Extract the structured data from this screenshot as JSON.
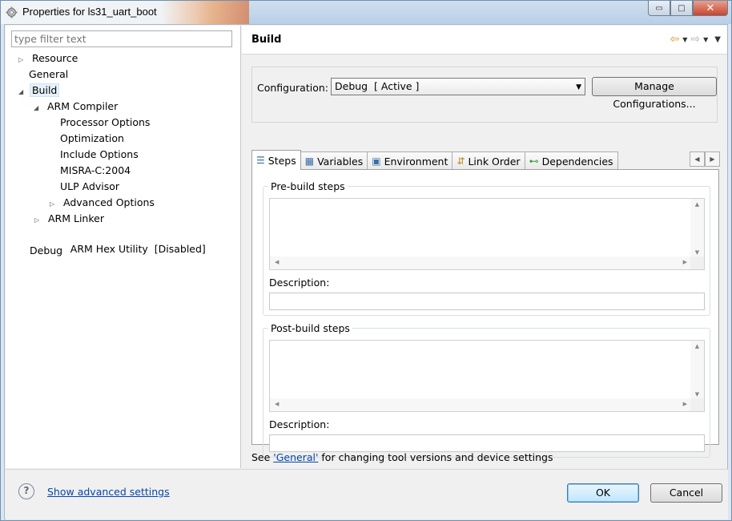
{
  "window": {
    "title": "Properties for ls31_uart_boot",
    "controls": {
      "minimize": "▭",
      "maximize": "□",
      "close": "✕"
    }
  },
  "filter": {
    "placeholder": "type filter text",
    "value": ""
  },
  "tree": {
    "items": [
      {
        "label": "Resource",
        "arrow": "▷"
      },
      {
        "label": "General",
        "arrow": ""
      },
      {
        "label": "Build",
        "arrow": "◢"
      },
      {
        "label": "ARM Compiler",
        "arrow": "◢"
      },
      {
        "label": "Processor Options",
        "arrow": ""
      },
      {
        "label": "Optimization",
        "arrow": ""
      },
      {
        "label": "Include Options",
        "arrow": ""
      },
      {
        "label": "MISRA-C:2004",
        "arrow": ""
      },
      {
        "label": "ULP Advisor",
        "arrow": ""
      },
      {
        "label": "Advanced Options",
        "arrow": "▷"
      },
      {
        "label": "ARM Linker",
        "arrow": "▷"
      },
      {
        "label": "ARM Hex Utility  [Disabled]",
        "arrow": ""
      },
      {
        "label": "Debug",
        "arrow": ""
      }
    ],
    "selected": "Build"
  },
  "header": {
    "title": "Build",
    "nav": {
      "back": "⇦",
      "forward": "⇨",
      "dropdown": "▼",
      "menu": "▼"
    }
  },
  "configuration": {
    "label": "Configuration:",
    "selected": "Debug  [ Active ]",
    "caret": "▼",
    "manage_button": "Manage Configurations..."
  },
  "tabs": [
    {
      "label": "Steps",
      "icon": "☰",
      "icon_name": "steps-icon",
      "active": true
    },
    {
      "label": "Variables",
      "icon": "▦",
      "icon_name": "variables-icon",
      "active": false
    },
    {
      "label": "Environment",
      "icon": "▣",
      "icon_name": "environment-icon",
      "active": false
    },
    {
      "label": "Link Order",
      "icon": "⇵",
      "icon_name": "link-order-icon",
      "active": false
    },
    {
      "label": "Dependencies",
      "icon": "⊷",
      "icon_name": "dependencies-icon",
      "active": false
    }
  ],
  "tab_scroll": {
    "left": "◀",
    "right": "▶"
  },
  "pre_build": {
    "title": "Pre-build steps",
    "description_label": "Description:",
    "value": "",
    "description_value": ""
  },
  "post_build": {
    "title": "Post-build steps",
    "description_label": "Description:",
    "value": "",
    "description_value": ""
  },
  "scroll_glyphs": {
    "up": "▲",
    "down": "▼",
    "left": "◀",
    "right": "▶"
  },
  "see_line": {
    "prefix": "See ",
    "link": "'General'",
    "suffix": " for changing tool versions and device settings"
  },
  "footer": {
    "help": "?",
    "advanced_link": "Show advanced settings",
    "ok": "OK",
    "cancel": "Cancel"
  },
  "colors": {
    "accent": "#3c7fb1",
    "link": "#0645ad",
    "title_fire": "#d9784a"
  }
}
